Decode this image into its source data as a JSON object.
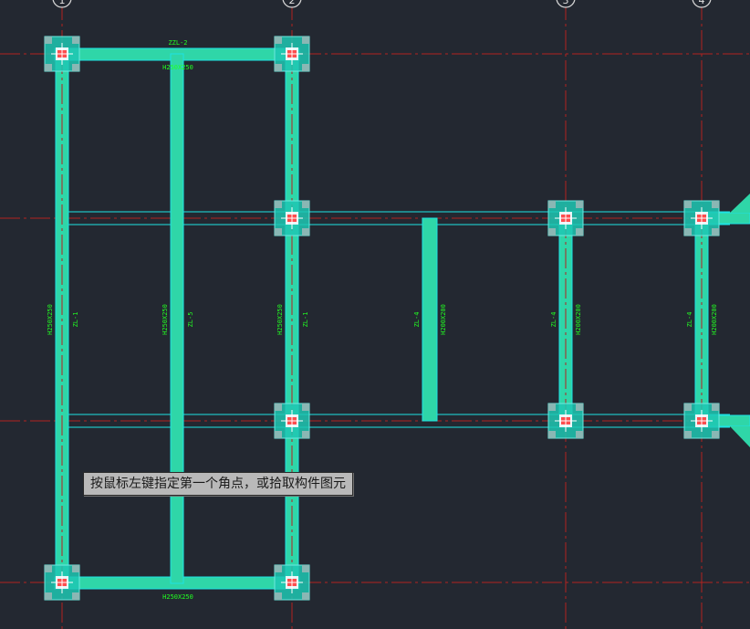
{
  "status_prompt": "按鼠标左键指定第一个角点，或拾取构件图元",
  "grid_axes": [
    "1",
    "2",
    "3",
    "4"
  ],
  "beam_labels": [
    {
      "id": "top-1-2",
      "name": "ZZL-2",
      "section": "H250X250"
    },
    {
      "id": "bottom-1-2",
      "name": "",
      "section": "H250X250"
    },
    {
      "id": "v-axis1",
      "name": "ZL-1",
      "section": "H250X250"
    },
    {
      "id": "v-mid12",
      "name": "ZL-5",
      "section": "H250X250"
    },
    {
      "id": "v-axis2",
      "name": "ZL-1",
      "section": "H250X250"
    },
    {
      "id": "v-mid23",
      "name": "ZL-4",
      "section": "H200X200"
    },
    {
      "id": "v-axis3",
      "name": "ZL-4",
      "section": "H200X200"
    },
    {
      "id": "v-axis4",
      "name": "ZL-4",
      "section": "H200X200"
    }
  ],
  "colors": {
    "background": "#232831",
    "axis_line": "#b3221f",
    "beam_fill": "#2fd6a8",
    "beam_edge": "#1de3e3",
    "label": "#22ff22",
    "column": "#1fc7b3"
  }
}
